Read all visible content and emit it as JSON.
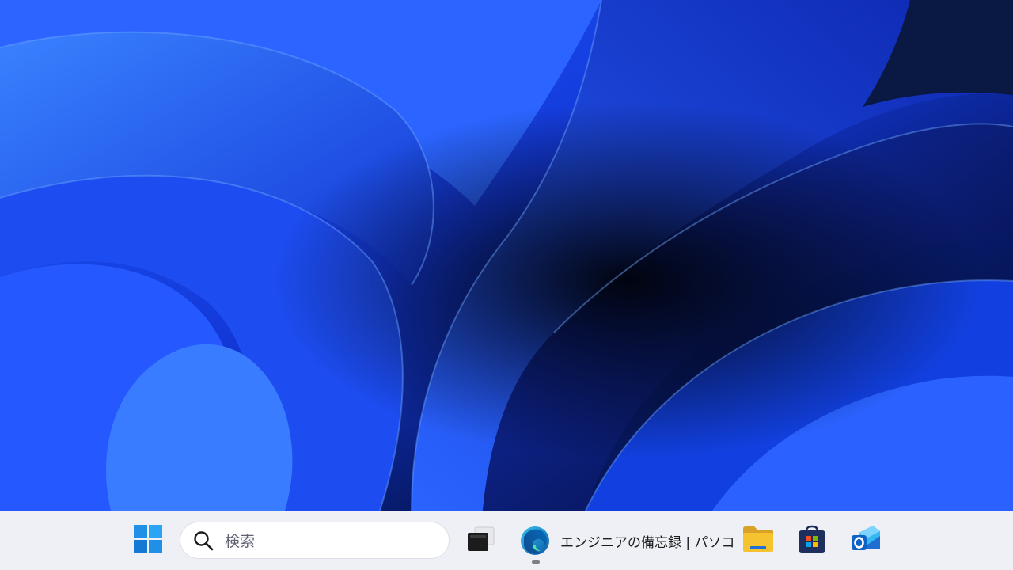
{
  "desktop": {
    "wallpaper": "windows-11-bloom-wallpaper",
    "colors": {
      "deep": "#06102e",
      "primary": "#1e4cff",
      "light": "#3f7dff"
    }
  },
  "taskbar": {
    "background": "#eef0f5",
    "start": {
      "icon": "windows-logo-icon"
    },
    "search": {
      "icon": "search-icon",
      "placeholder": "検索"
    },
    "task_view": {
      "icon": "task-view-icon"
    },
    "edge": {
      "icon": "edge-icon",
      "label": "エンジニアの備忘録 | パソコ",
      "running": true
    },
    "pinned": [
      {
        "name": "file-explorer",
        "icon": "folder-icon"
      },
      {
        "name": "microsoft-store",
        "icon": "store-icon"
      },
      {
        "name": "outlook",
        "icon": "outlook-icon"
      }
    ]
  }
}
